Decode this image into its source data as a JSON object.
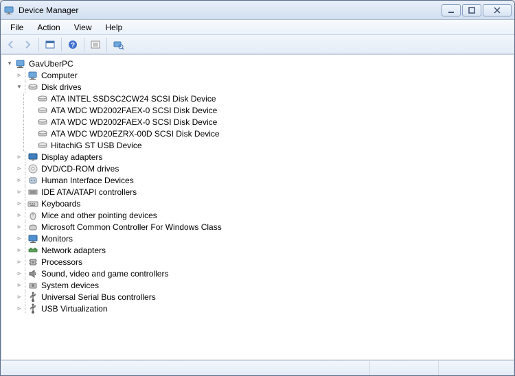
{
  "window": {
    "title": "Device Manager"
  },
  "menu": {
    "file": "File",
    "action": "Action",
    "view": "View",
    "help": "Help"
  },
  "tree": {
    "root": "GavUberPC",
    "nodes": [
      {
        "label": "Computer",
        "icon": "computer",
        "expanded": false,
        "children": []
      },
      {
        "label": "Disk drives",
        "icon": "disk",
        "expanded": true,
        "children": [
          {
            "label": "ATA INTEL SSDSC2CW24 SCSI Disk Device",
            "icon": "disk"
          },
          {
            "label": "ATA WDC WD2002FAEX-0 SCSI Disk Device",
            "icon": "disk"
          },
          {
            "label": "ATA WDC WD2002FAEX-0 SCSI Disk Device",
            "icon": "disk"
          },
          {
            "label": "ATA WDC WD20EZRX-00D SCSI Disk Device",
            "icon": "disk"
          },
          {
            "label": "HitachiG ST USB Device",
            "icon": "disk"
          }
        ]
      },
      {
        "label": "Display adapters",
        "icon": "display",
        "expanded": false,
        "children": []
      },
      {
        "label": "DVD/CD-ROM drives",
        "icon": "dvd",
        "expanded": false,
        "children": []
      },
      {
        "label": "Human Interface Devices",
        "icon": "hid",
        "expanded": false,
        "children": []
      },
      {
        "label": "IDE ATA/ATAPI controllers",
        "icon": "ide",
        "expanded": false,
        "children": []
      },
      {
        "label": "Keyboards",
        "icon": "keyboard",
        "expanded": false,
        "children": []
      },
      {
        "label": "Mice and other pointing devices",
        "icon": "mouse",
        "expanded": false,
        "children": []
      },
      {
        "label": "Microsoft Common Controller For Windows Class",
        "icon": "controller",
        "expanded": false,
        "children": []
      },
      {
        "label": "Monitors",
        "icon": "monitor",
        "expanded": false,
        "children": []
      },
      {
        "label": "Network adapters",
        "icon": "network",
        "expanded": false,
        "children": []
      },
      {
        "label": "Processors",
        "icon": "processor",
        "expanded": false,
        "children": []
      },
      {
        "label": "Sound, video and game controllers",
        "icon": "sound",
        "expanded": false,
        "children": []
      },
      {
        "label": "System devices",
        "icon": "system",
        "expanded": false,
        "children": []
      },
      {
        "label": "Universal Serial Bus controllers",
        "icon": "usb",
        "expanded": false,
        "children": []
      },
      {
        "label": "USB Virtualization",
        "icon": "usb",
        "expanded": false,
        "children": []
      }
    ]
  }
}
